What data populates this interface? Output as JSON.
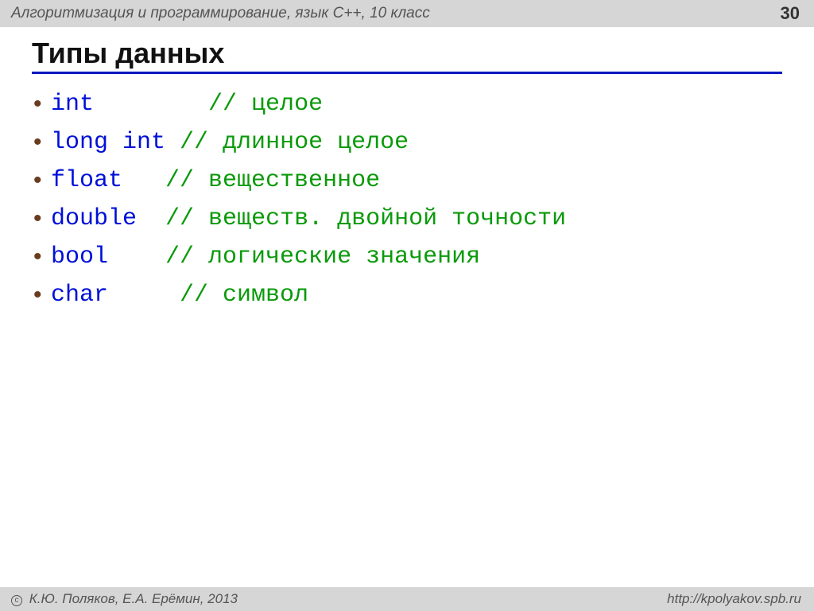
{
  "header": {
    "title": "Алгоритмизация и программирование, язык  С++, 10 класс",
    "page_number": "30"
  },
  "slide": {
    "title": "Типы данных",
    "items": [
      {
        "keyword": "int",
        "pad": "        ",
        "comment": "// целое"
      },
      {
        "keyword": "long int",
        "pad": " ",
        "comment": "// длинное целое"
      },
      {
        "keyword": "float",
        "pad": "   ",
        "comment": "// вещественное"
      },
      {
        "keyword": "double",
        "pad": "  ",
        "comment": "// веществ. двойной точности"
      },
      {
        "keyword": "bool",
        "pad": "    ",
        "comment": "// логические значения"
      },
      {
        "keyword": "char",
        "pad": "    ",
        "comment": " // символ"
      }
    ]
  },
  "footer": {
    "copyright": " К.Ю. Поляков, Е.А. Ерёмин, 2013",
    "url": "http://kpolyakov.spb.ru"
  }
}
